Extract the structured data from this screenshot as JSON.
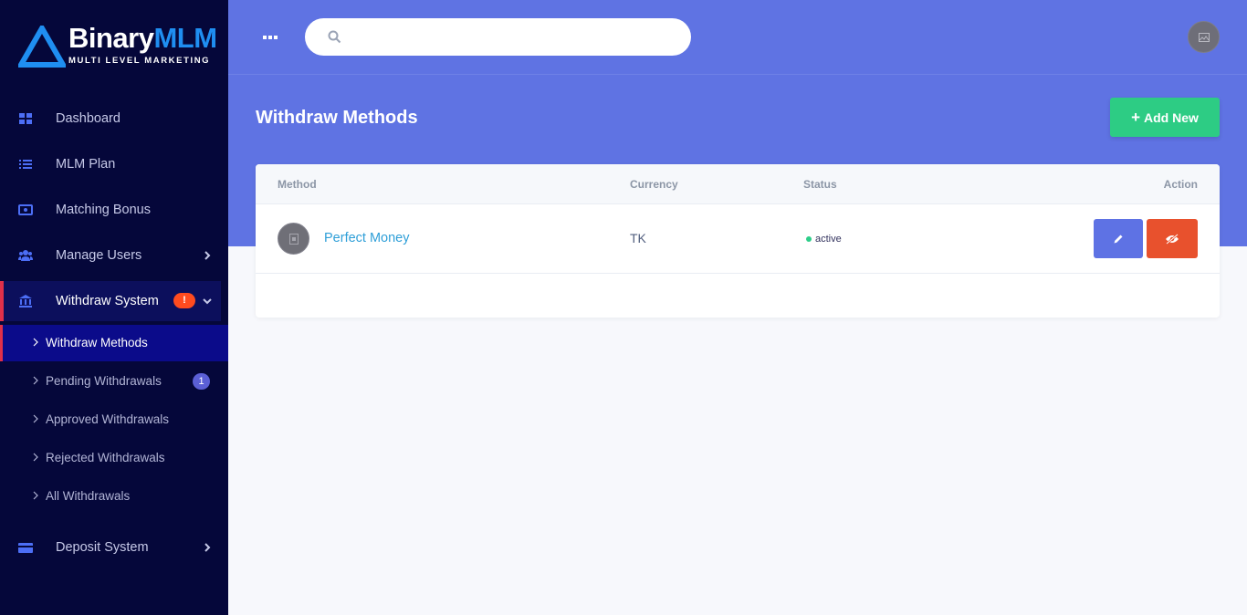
{
  "brand": {
    "name_part1": "Binary",
    "name_part2": "MLM",
    "tagline": "MULTI LEVEL MARKETING",
    "colors": {
      "white": "#ffffff",
      "blue": "#1f8ef1"
    }
  },
  "sidebar": {
    "items": [
      {
        "label": "Dashboard",
        "icon": "dashboard-grid-icon"
      },
      {
        "label": "MLM Plan",
        "icon": "list-icon"
      },
      {
        "label": "Matching Bonus",
        "icon": "money-bill-icon"
      },
      {
        "label": "Manage Users",
        "icon": "users-icon"
      },
      {
        "label": "Withdraw System",
        "icon": "bank-icon",
        "badge": "!"
      }
    ],
    "withdraw_sub": [
      {
        "label": "Withdraw Methods"
      },
      {
        "label": "Pending Withdrawals",
        "badge": "1"
      },
      {
        "label": "Approved Withdrawals"
      },
      {
        "label": "Rejected Withdrawals"
      },
      {
        "label": "All Withdrawals"
      }
    ],
    "after": [
      {
        "label": "Deposit System",
        "icon": "credit-card-icon"
      }
    ]
  },
  "header": {
    "search": {
      "value": "",
      "placeholder": ""
    }
  },
  "page": {
    "title": "Withdraw Methods",
    "add_button": "Add New"
  },
  "table": {
    "columns": [
      "Method",
      "Currency",
      "Status",
      "Action"
    ],
    "rows": [
      {
        "method": "Perfect Money",
        "currency": "TK",
        "status": "active"
      }
    ]
  },
  "colors": {
    "sidebar_bg": "#05073a",
    "accent": "#5f73e3",
    "success": "#2dcc84",
    "danger": "#e8512d",
    "active_marker": "#e0304a"
  }
}
